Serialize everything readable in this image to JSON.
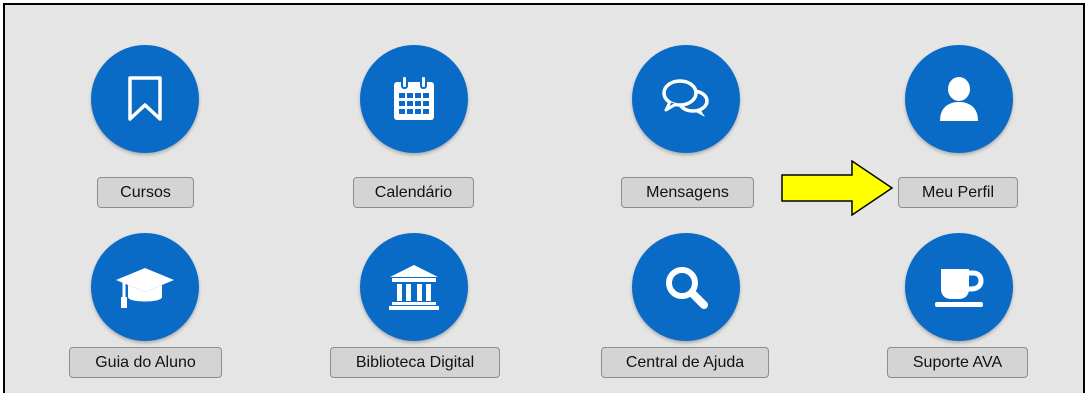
{
  "tiles": [
    {
      "label": "Cursos",
      "icon": "bookmark-icon"
    },
    {
      "label": "Calendário",
      "icon": "calendar-icon"
    },
    {
      "label": "Mensagens",
      "icon": "chat-bubbles-icon"
    },
    {
      "label": "Meu Perfil",
      "icon": "user-icon"
    },
    {
      "label": "Guia do Aluno",
      "icon": "graduation-cap-icon"
    },
    {
      "label": "Biblioteca Digital",
      "icon": "library-icon"
    },
    {
      "label": "Central de Ajuda",
      "icon": "search-icon"
    },
    {
      "label": "Suporte AVA",
      "icon": "coffee-cup-icon"
    }
  ],
  "colors": {
    "accent": "#0a6bc7",
    "background": "#e5e5e5",
    "button": "#d4d4d4",
    "arrow": "#ffff00"
  }
}
